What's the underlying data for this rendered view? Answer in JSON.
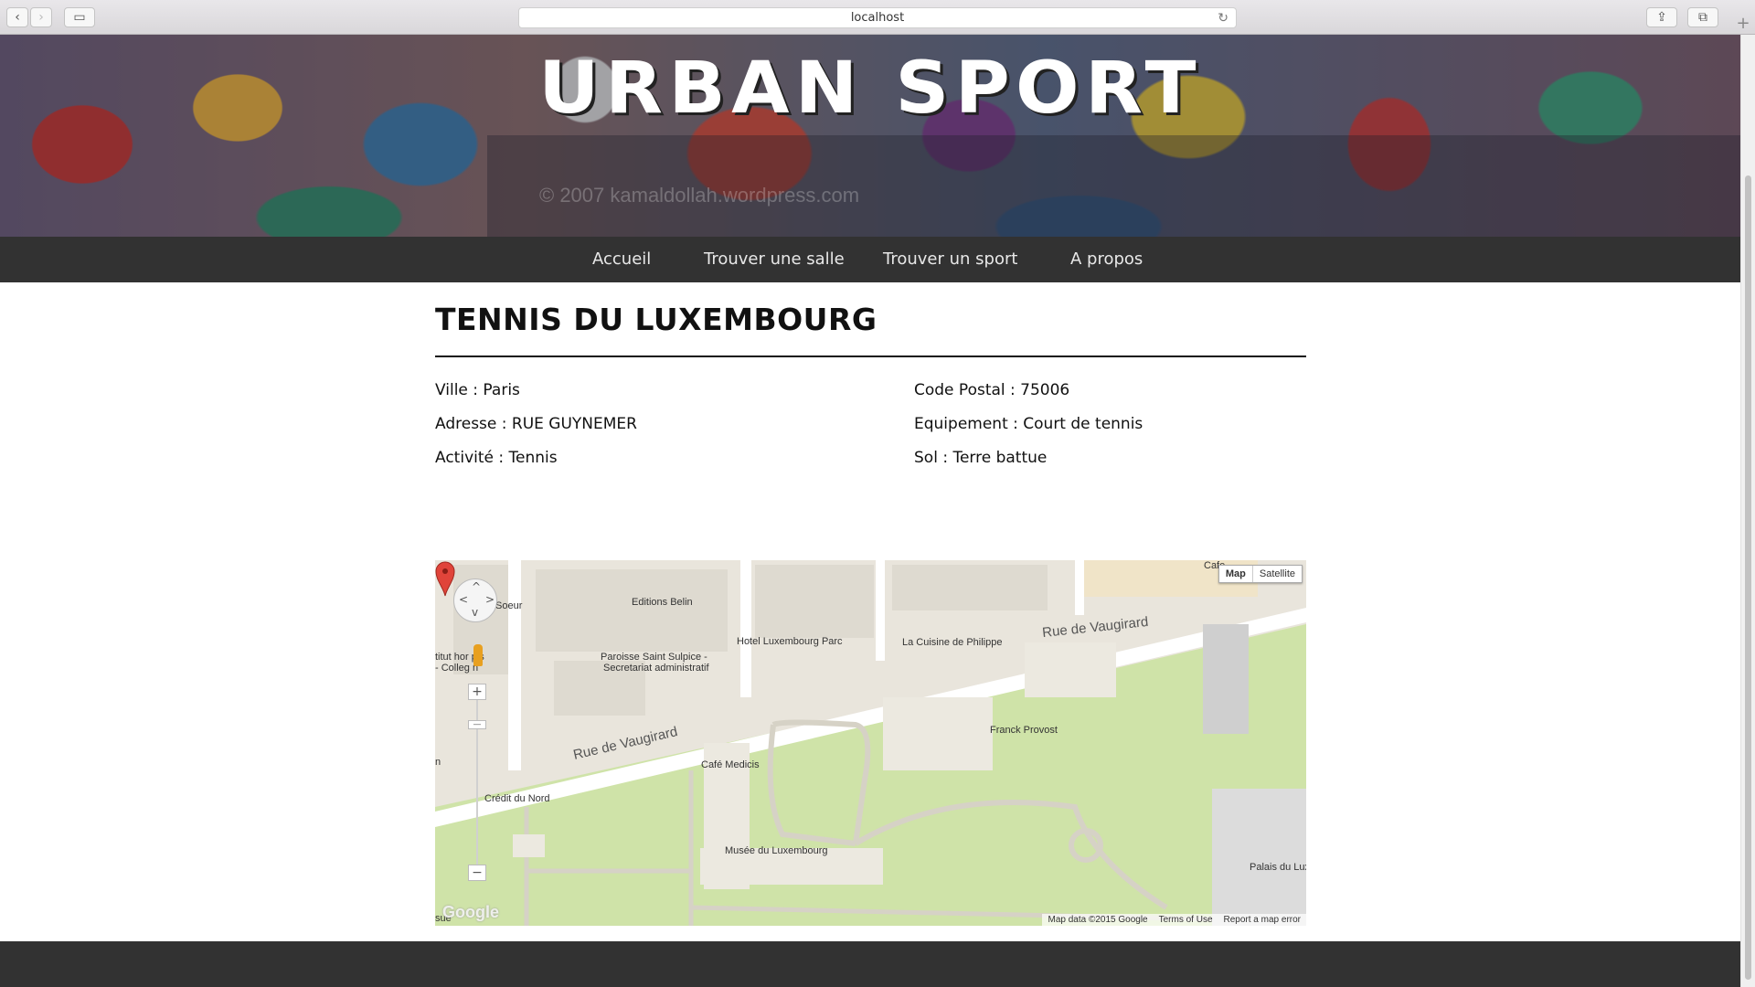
{
  "browser": {
    "url": "localhost",
    "back_glyph": "‹",
    "forward_glyph": "›",
    "sidebar_glyph": "▭",
    "share_glyph": "⇪",
    "tabs_glyph": "⧉",
    "reload_glyph": "↻",
    "new_tab_glyph": "+"
  },
  "banner": {
    "title": "URBAN SPORT",
    "copyright": "© 2007 kamaldollah.wordpress.com"
  },
  "nav": {
    "items": [
      "Accueil",
      "Trouver une salle",
      "Trouver un sport",
      "A propos"
    ]
  },
  "facility": {
    "title": "TENNIS DU LUXEMBOURG",
    "ville": "Ville : Paris",
    "adresse": "Adresse : RUE GUYNEMER",
    "activite": "Activité : Tennis",
    "code_postal": "Code Postal : 75006",
    "equipement": "Equipement : Court de tennis",
    "sol": "Sol : Terre battue"
  },
  "map": {
    "type_map": "Map",
    "type_satellite": "Satellite",
    "streets": [
      "Rue de Vaugirard",
      "Rue de Vaugirard"
    ],
    "places": [
      "Editions Belin",
      "Hotel Luxembourg Parc",
      "La Cuisine de Philippe",
      "Paroisse Saint Sulpice -",
      "Secretariat administratif",
      "Franck Provost",
      "Café Medicis",
      "Crédit du Nord",
      "Musée du Luxembourg",
      "Palais du Luxembo",
      "Cafe",
      "Soeur",
      "titut hor   pis",
      "- Colleg   n",
      "n",
      "sue"
    ],
    "google_logo": "Google",
    "footer": [
      "Map data ©2015 Google",
      "Terms of Use",
      "Report a map error"
    ],
    "pan_up": "^",
    "pan_left": "<",
    "pan_right": ">",
    "pan_down": "v",
    "zoom_in": "+",
    "zoom_out": "−",
    "zoom_mid": "—"
  },
  "colors": {
    "nav_bg": "#323232",
    "park_green": "#cfe3a8",
    "road": "#ffffff",
    "pin_red": "#e0443a"
  }
}
